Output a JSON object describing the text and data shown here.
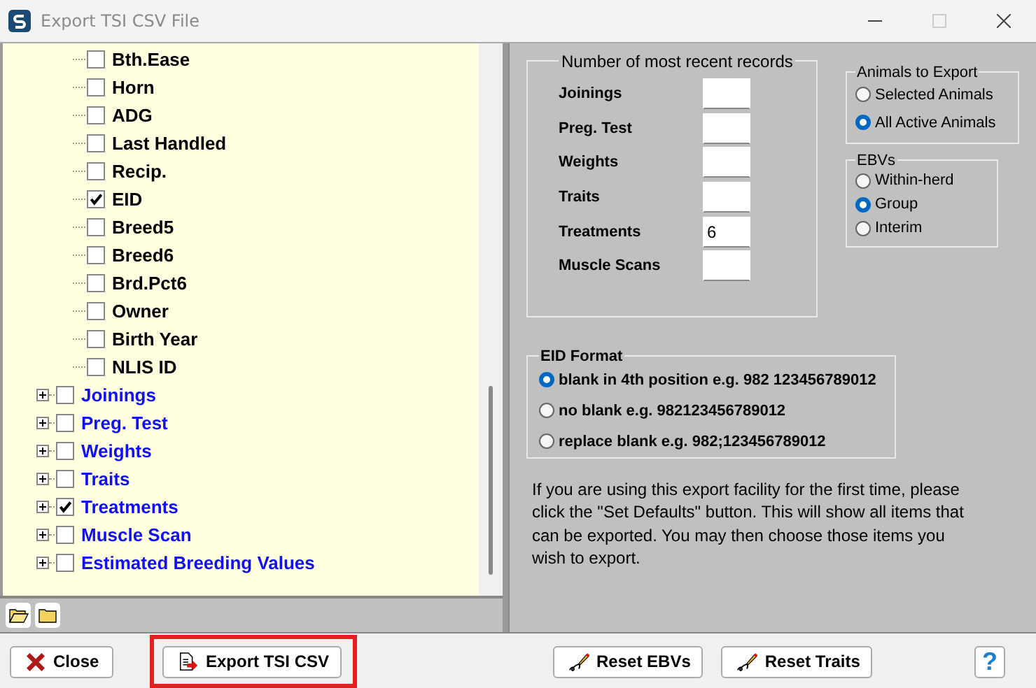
{
  "window": {
    "title": "Export TSI CSV File"
  },
  "tree": {
    "child_items": [
      {
        "label": "Bth.Ease",
        "checked": false
      },
      {
        "label": "Horn",
        "checked": false
      },
      {
        "label": "ADG",
        "checked": false
      },
      {
        "label": "Last Handled",
        "checked": false
      },
      {
        "label": "Recip.",
        "checked": false
      },
      {
        "label": "EID",
        "checked": true
      },
      {
        "label": "Breed5",
        "checked": false
      },
      {
        "label": "Breed6",
        "checked": false
      },
      {
        "label": "Brd.Pct6",
        "checked": false
      },
      {
        "label": "Owner",
        "checked": false
      },
      {
        "label": "Birth Year",
        "checked": false
      },
      {
        "label": "NLIS ID",
        "checked": false
      }
    ],
    "items": [
      {
        "label": "Joinings",
        "checked": false,
        "expanded": false
      },
      {
        "label": "Preg. Test",
        "checked": false,
        "expanded": false
      },
      {
        "label": "Weights",
        "checked": false,
        "expanded": false
      },
      {
        "label": "Traits",
        "checked": false,
        "expanded": false
      },
      {
        "label": "Treatments",
        "checked": true,
        "expanded": false
      },
      {
        "label": "Muscle Scan",
        "checked": false,
        "expanded": false
      },
      {
        "label": "Estimated Breeding Values",
        "checked": false,
        "expanded": false
      }
    ]
  },
  "records": {
    "title": "Number of most recent records",
    "rows": [
      {
        "label": "Joinings"
      },
      {
        "label": "Preg. Test"
      },
      {
        "label": "Weights"
      },
      {
        "label": "Traits"
      },
      {
        "label": "Treatments",
        "value": "6"
      },
      {
        "label": "Muscle Scans"
      }
    ]
  },
  "animals_to_export": {
    "title": "Animals to Export",
    "options": [
      {
        "label": "Selected Animals",
        "selected": false
      },
      {
        "label": "All Active Animals",
        "selected": true
      }
    ]
  },
  "ebvs": {
    "title": "EBVs",
    "options": [
      {
        "label": "Within-herd",
        "selected": false
      },
      {
        "label": "Group",
        "selected": true
      },
      {
        "label": "Interim",
        "selected": false
      }
    ]
  },
  "eid_format": {
    "title": "EID Format",
    "options": [
      {
        "label": "blank in 4th position e.g. 982 123456789012",
        "selected": true
      },
      {
        "label": "no blank e.g. 982123456789012",
        "selected": false
      },
      {
        "label": "replace blank e.g. 982;123456789012",
        "selected": false
      }
    ]
  },
  "note": "If you are using this export facility for the first time, please click the \"Set Defaults\" button. This will show all items that can be exported. You may then choose those items you wish to export.",
  "buttons": [
    {
      "label": "Close",
      "kind": "close",
      "highlighted": false
    },
    {
      "label": "Export TSI CSV",
      "kind": "export",
      "highlighted": true
    },
    {
      "label": "Reset EBVs",
      "kind": "reset",
      "highlighted": false
    },
    {
      "label": "Reset Traits",
      "kind": "reset",
      "highlighted": false
    },
    {
      "label": "?",
      "kind": "help",
      "highlighted": false
    }
  ]
}
